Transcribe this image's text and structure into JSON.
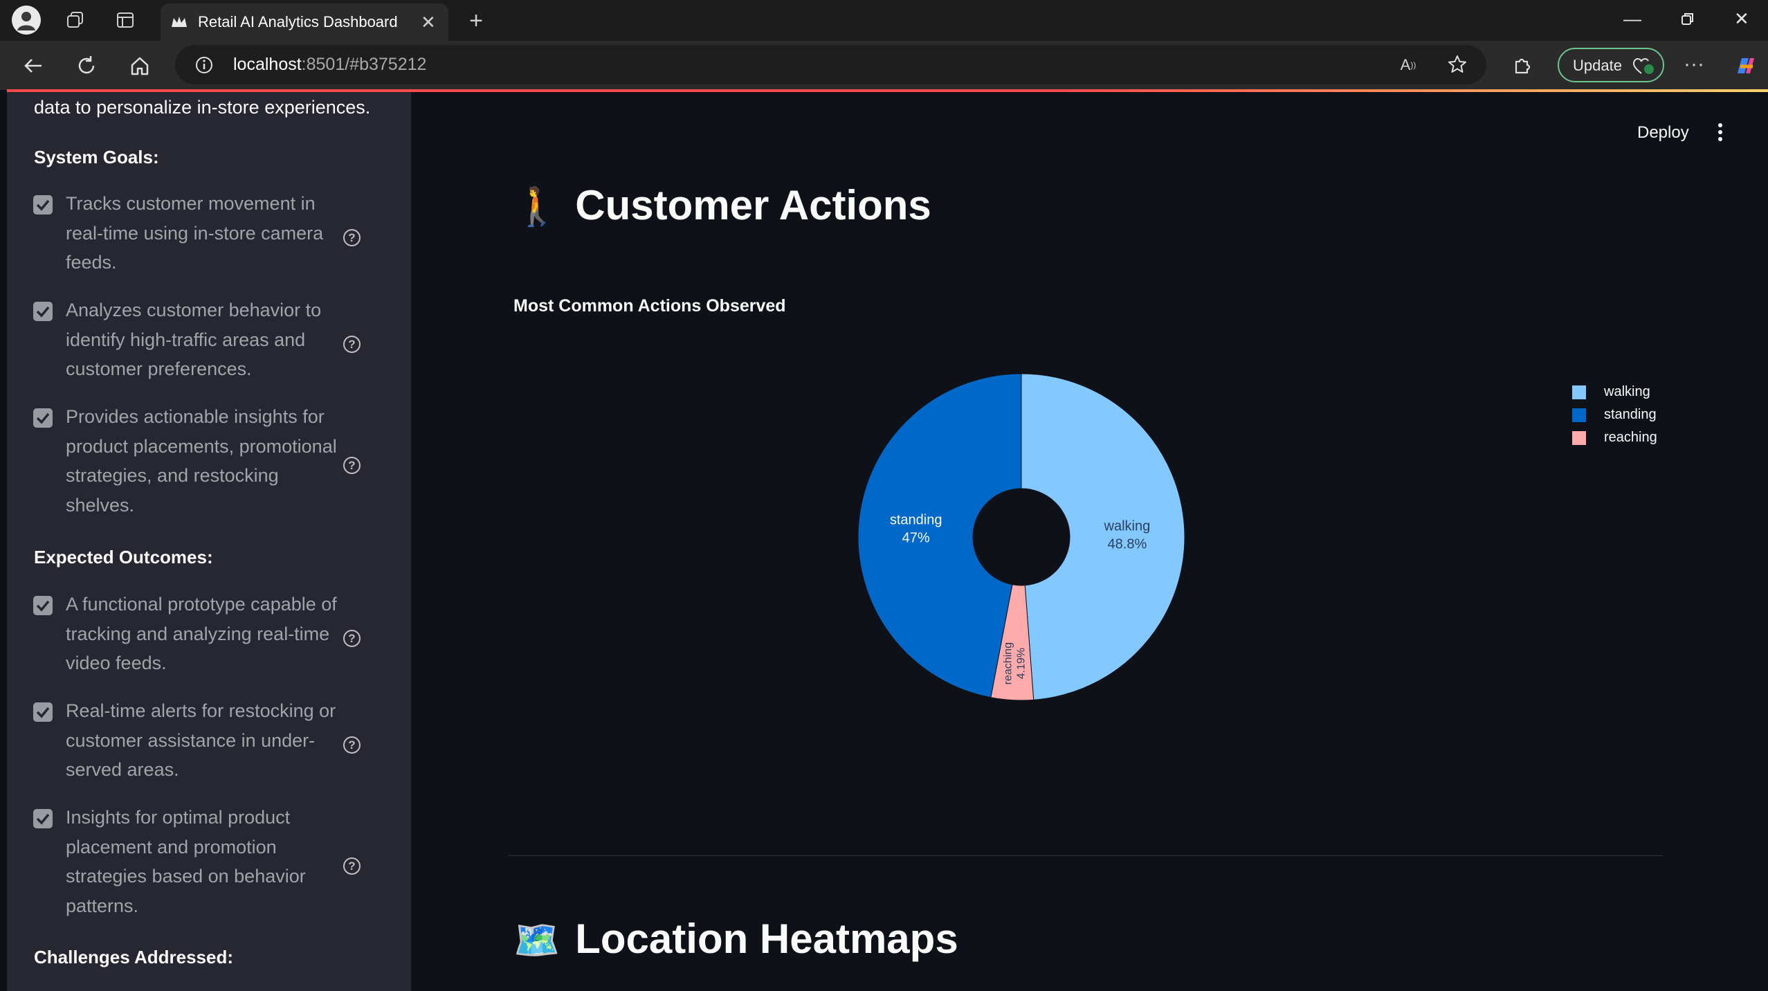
{
  "browser": {
    "tab_title": "Retail AI Analytics Dashboard",
    "url_host": "localhost",
    "url_rest": ":8501/#b375212",
    "update_label": "Update"
  },
  "sidebar": {
    "intro_text": "data to personalize in-store experiences.",
    "system_goals_title": "System Goals:",
    "system_goals": [
      {
        "lines": [
          "Tracks customer movement in",
          "real-time using in-store camera",
          "feeds."
        ]
      },
      {
        "lines": [
          "Analyzes customer behavior to",
          "identify high-traffic areas and",
          "customer preferences."
        ]
      },
      {
        "lines": [
          "Provides actionable insights for",
          "product placements, promotional",
          "strategies, and restocking",
          "shelves."
        ]
      }
    ],
    "expected_outcomes_title": "Expected Outcomes:",
    "expected_outcomes": [
      {
        "lines": [
          "A functional prototype capable of",
          "tracking and analyzing real-time",
          "video feeds."
        ]
      },
      {
        "lines": [
          "Real-time alerts for restocking or",
          "customer assistance in under-",
          "served areas."
        ]
      },
      {
        "lines": [
          "Insights for optimal product",
          "placement and promotion",
          "strategies based on behavior",
          "patterns."
        ]
      }
    ],
    "challenges_title": "Challenges Addressed:"
  },
  "main": {
    "deploy_label": "Deploy",
    "customer_actions_emoji": "🚶",
    "customer_actions_title": "Customer Actions",
    "location_heatmaps_emoji": "🗺️",
    "location_heatmaps_title": "Location Heatmaps"
  },
  "chart_data": {
    "type": "pie",
    "title": "Most Common Actions Observed",
    "hole": true,
    "legend_position": "top-right",
    "slices": [
      {
        "label": "walking",
        "percent": 48.8,
        "percent_label": "48.8%",
        "color": "#83c9ff"
      },
      {
        "label": "reaching",
        "percent": 4.19,
        "percent_label": "4.19%",
        "color": "#ffabab"
      },
      {
        "label": "standing",
        "percent": 47.0,
        "percent_label": "47%",
        "color": "#0068c9"
      }
    ]
  }
}
